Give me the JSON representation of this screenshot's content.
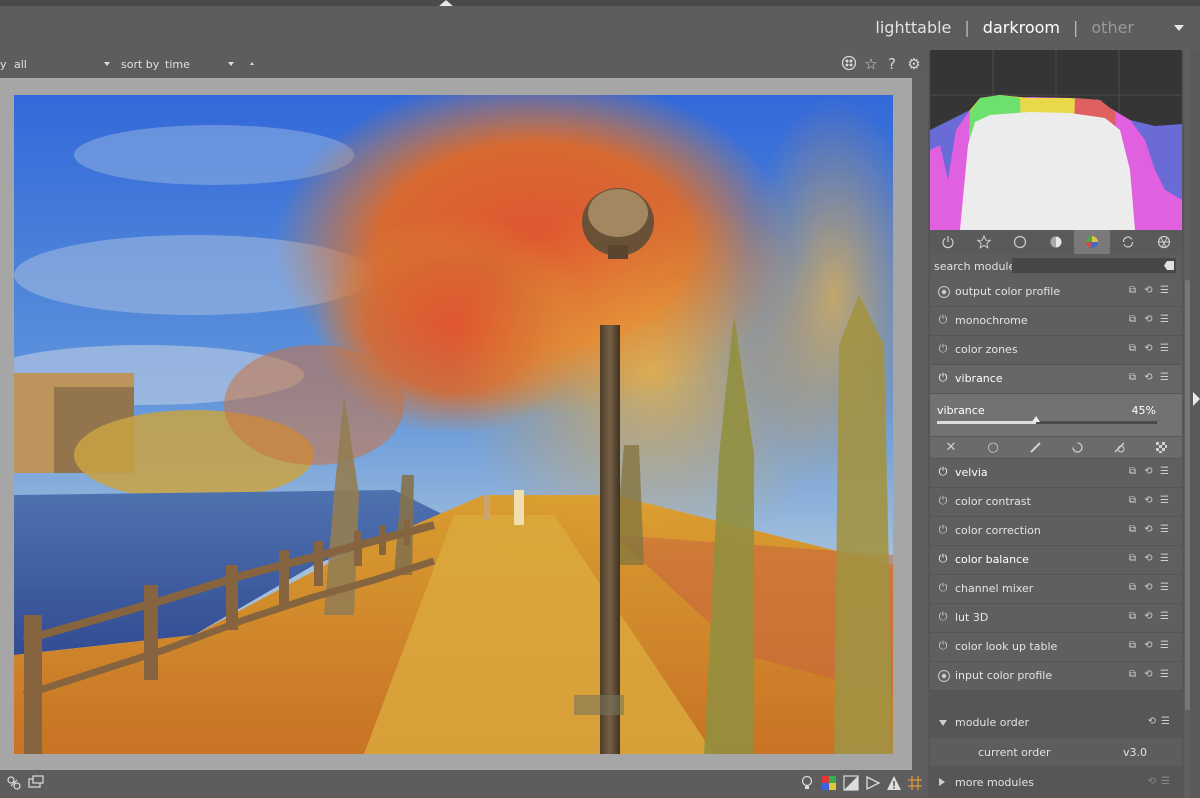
{
  "header": {
    "views": [
      {
        "label": "lighttable",
        "state": "normal"
      },
      {
        "label": "darkroom",
        "state": "active"
      },
      {
        "label": "other",
        "state": "dim"
      }
    ],
    "separator": "|"
  },
  "filterbar": {
    "left_fragment": "y",
    "filter_value": "all",
    "sort_label": "sort by",
    "sort_value": "time"
  },
  "right_panel": {
    "group_tabs": [
      "power-icon",
      "star-icon",
      "circle-icon",
      "half-circle-icon",
      "color-circle-icon",
      "refresh-icon",
      "aperture-icon"
    ],
    "active_group_tab": 4,
    "search": {
      "label": "search module",
      "value": ""
    },
    "modules": [
      {
        "name": "output color profile",
        "power": "preset",
        "enabled": false
      },
      {
        "name": "monochrome",
        "power": "off",
        "enabled": false
      },
      {
        "name": "color zones",
        "power": "off",
        "enabled": false
      },
      {
        "name": "vibrance",
        "power": "on",
        "enabled": true,
        "expanded": true
      },
      {
        "name": "velvia",
        "power": "on",
        "enabled": true
      },
      {
        "name": "color contrast",
        "power": "off",
        "enabled": false
      },
      {
        "name": "color correction",
        "power": "off",
        "enabled": false
      },
      {
        "name": "color balance",
        "power": "on",
        "enabled": true
      },
      {
        "name": "channel mixer",
        "power": "off",
        "enabled": false
      },
      {
        "name": "lut 3D",
        "power": "off",
        "enabled": false
      },
      {
        "name": "color look up table",
        "power": "off",
        "enabled": false
      },
      {
        "name": "input color profile",
        "power": "preset",
        "enabled": false
      }
    ],
    "vibrance": {
      "label": "vibrance",
      "value_text": "45%",
      "value": 45
    },
    "blend_modes": [
      "off-x-icon",
      "uniform-circle-icon",
      "drawn-mask-icon",
      "parametric-mask-icon",
      "drawn-parametric-icon",
      "raster-mask-icon"
    ],
    "module_order": {
      "title": "module order",
      "current_label": "current order",
      "current_value": "v3.0"
    },
    "more_modules": {
      "label": "more modules"
    }
  },
  "colors": {
    "panel_bg": "#565656",
    "active_text": "#ffffff",
    "center_bg": "#a6a6a6"
  }
}
